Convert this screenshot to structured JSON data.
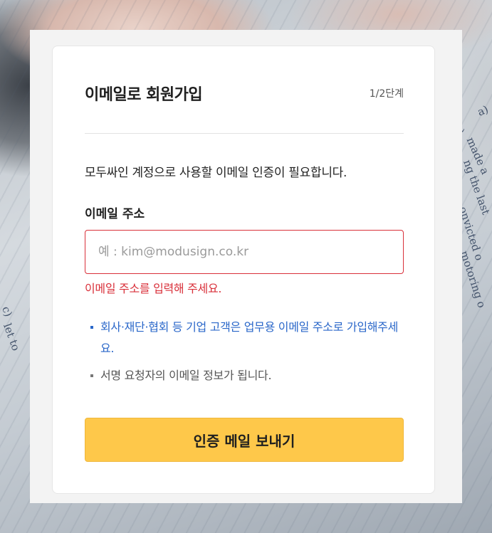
{
  "background": {
    "snippets": [
      "a)",
      "b)",
      "made a",
      "ng the last",
      "onvicted o",
      "motoring o",
      "c)",
      "let to"
    ]
  },
  "signup": {
    "title": "이메일로 회원가입",
    "step": "1/2단계",
    "description": "모두싸인 계정으로 사용할 이메일 인증이 필요합니다.",
    "email_label": "이메일 주소",
    "email_value": "",
    "email_placeholder": "예 : kim@modusign.co.kr",
    "error_message": "이메일 주소를 입력해 주세요.",
    "notes": [
      "회사·재단·협회 등 기업 고객은 업무용 이메일 주소로 가입해주세요.",
      "서명 요청자의 이메일 정보가 됩니다."
    ],
    "send_button": "인증 메일 보내기"
  },
  "colors": {
    "error": "#d9303a",
    "note_blue": "#2a67c9",
    "button_yellow": "#fec84a"
  }
}
